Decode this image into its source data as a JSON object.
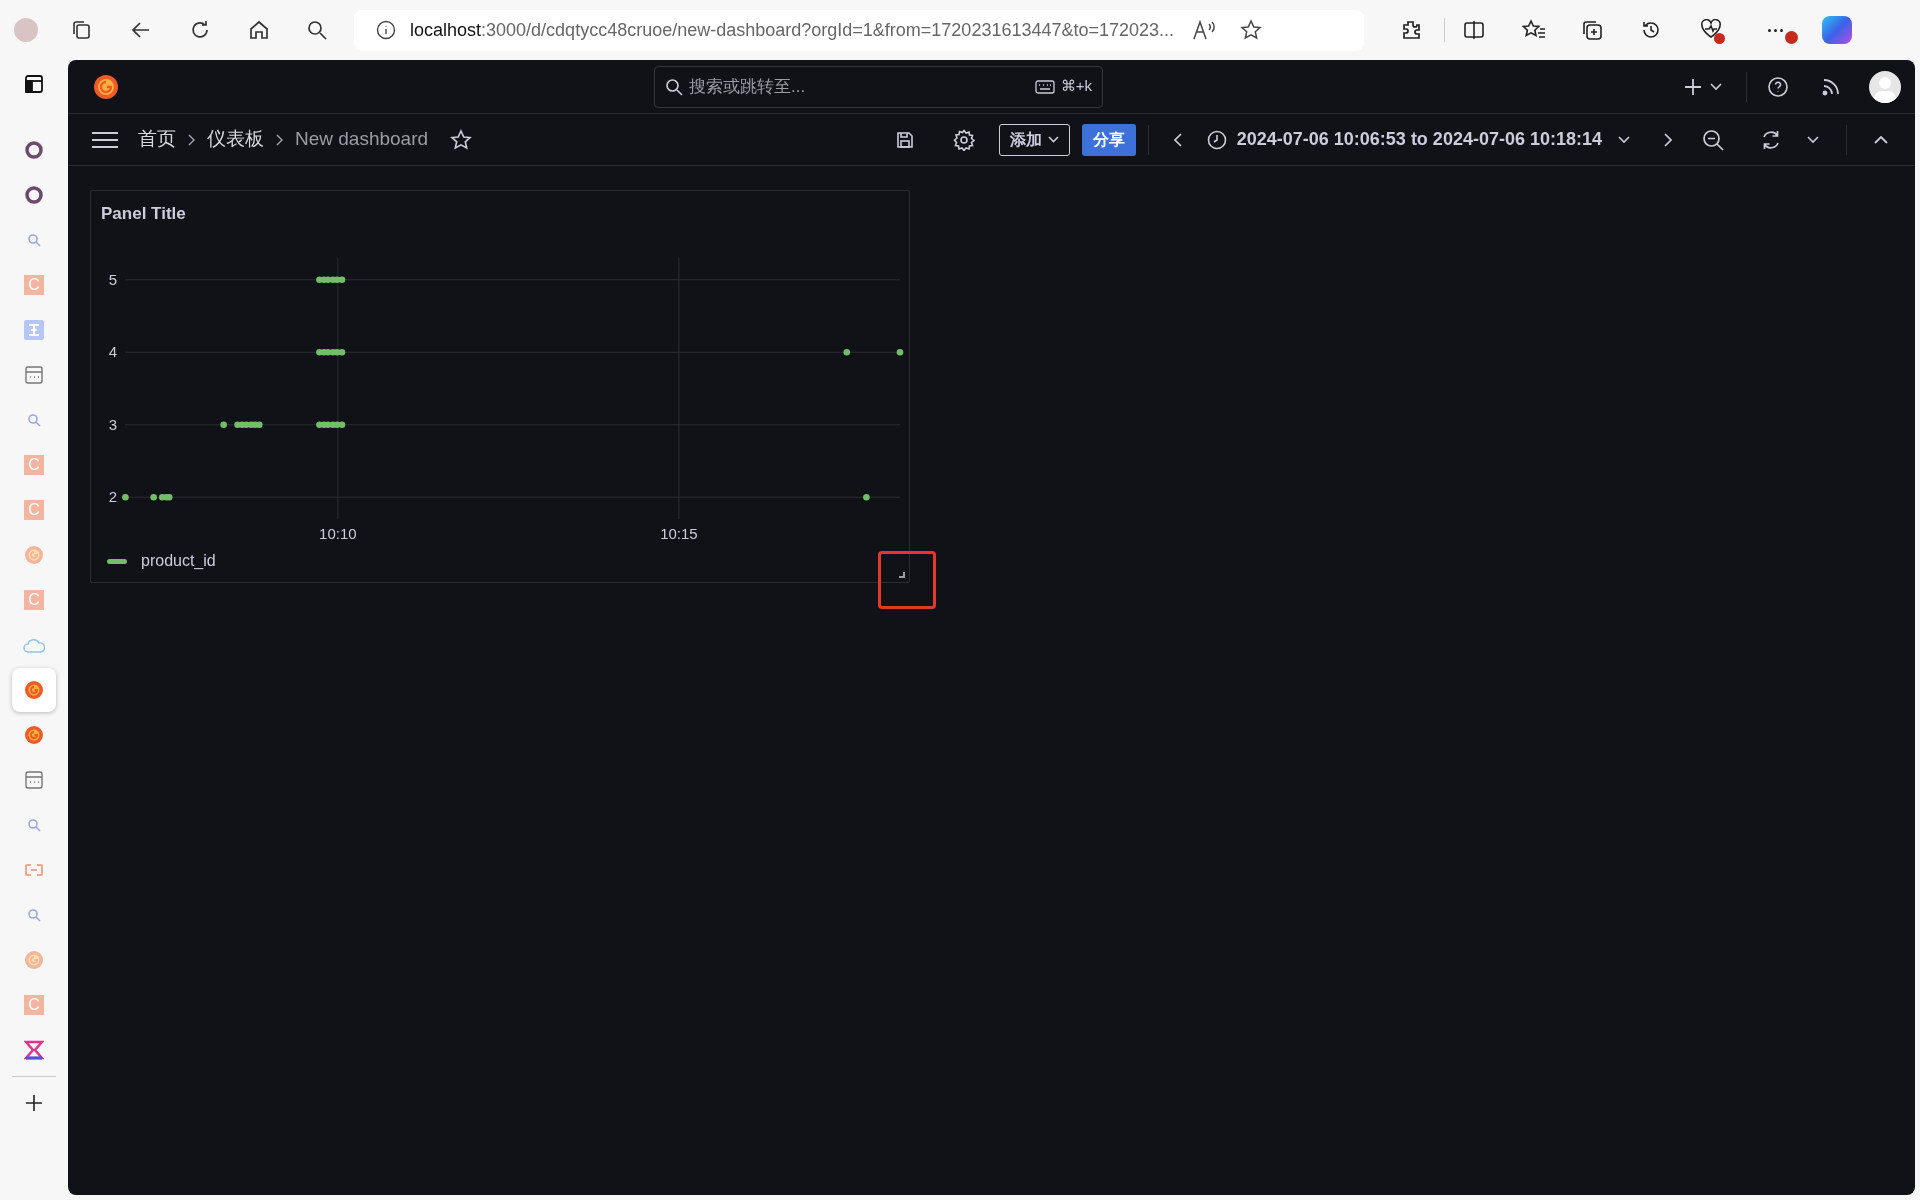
{
  "browser": {
    "url": {
      "host": "localhost",
      "rest": ":3000/d/cdqtycc48cruoe/new-dashboard?orgId=1&from=1720231613447&to=172023..."
    },
    "tabs": [
      {
        "kind": "ring",
        "selected": false
      },
      {
        "kind": "ring",
        "selected": false
      },
      {
        "kind": "search",
        "selected": false
      },
      {
        "kind": "c-logo",
        "label": "C",
        "selected": false
      },
      {
        "kind": "h-logo",
        "selected": false
      },
      {
        "kind": "calendar",
        "selected": false
      },
      {
        "kind": "search",
        "selected": false
      },
      {
        "kind": "c-logo",
        "label": "C",
        "selected": false
      },
      {
        "kind": "c-logo",
        "label": "C",
        "selected": false
      },
      {
        "kind": "grafana-pale",
        "selected": false
      },
      {
        "kind": "c-logo",
        "label": "C",
        "selected": false
      },
      {
        "kind": "cloud",
        "selected": false
      },
      {
        "kind": "grafana",
        "selected": true
      },
      {
        "kind": "grafana",
        "selected": false
      },
      {
        "kind": "calendar",
        "selected": false
      },
      {
        "kind": "search",
        "selected": false
      },
      {
        "kind": "link",
        "selected": false
      },
      {
        "kind": "search",
        "selected": false
      },
      {
        "kind": "grafana-pale",
        "selected": false
      },
      {
        "kind": "c-logo",
        "label": "C",
        "selected": false
      },
      {
        "kind": "x-logo",
        "selected": false
      }
    ]
  },
  "header": {
    "search": {
      "placeholder": "搜索或跳转至...",
      "shortcut": "⌘+k"
    }
  },
  "toolbar": {
    "breadcrumbs": [
      {
        "label": "首页",
        "current": false
      },
      {
        "label": "仪表板",
        "current": false
      },
      {
        "label": "New dashboard",
        "current": true
      }
    ],
    "add_button": "添加",
    "share_button": "分享",
    "time_range": "2024-07-06 10:06:53 to 2024-07-06 10:18:14"
  },
  "panel": {
    "title": "Panel Title",
    "chart_data": {
      "type": "scatter",
      "grid": true,
      "x": [
        10.1148,
        10.1217,
        10.1238,
        10.1248,
        10.1255,
        10.2958,
        10.1388,
        10.1422,
        10.1433,
        10.1443,
        10.1455,
        10.1465,
        10.1475,
        10.1622,
        10.1633,
        10.1643,
        10.1655,
        10.1665,
        10.1677,
        10.1622,
        10.1633,
        10.1643,
        10.1655,
        10.1665,
        10.1677,
        10.291,
        10.304,
        10.1622,
        10.1633,
        10.1643,
        10.1655,
        10.1665,
        10.1677
      ],
      "series": [
        {
          "name": "product_id",
          "color": "#73bf69",
          "values": [
            2,
            2,
            2,
            2,
            2,
            2,
            3,
            3,
            3,
            3,
            3,
            3,
            3,
            3,
            3,
            3,
            3,
            3,
            3,
            4,
            4,
            4,
            4,
            4,
            4,
            4,
            4,
            5,
            5,
            5,
            5,
            5,
            5
          ]
        }
      ],
      "xlim": [
        10.1147,
        10.304
      ],
      "ylim": [
        1.7,
        5.3
      ],
      "xticks": [
        {
          "value": 10.1667,
          "label": "10:10"
        },
        {
          "value": 10.25,
          "label": "10:15"
        }
      ],
      "yticks": [
        2,
        3,
        4,
        5
      ]
    }
  }
}
